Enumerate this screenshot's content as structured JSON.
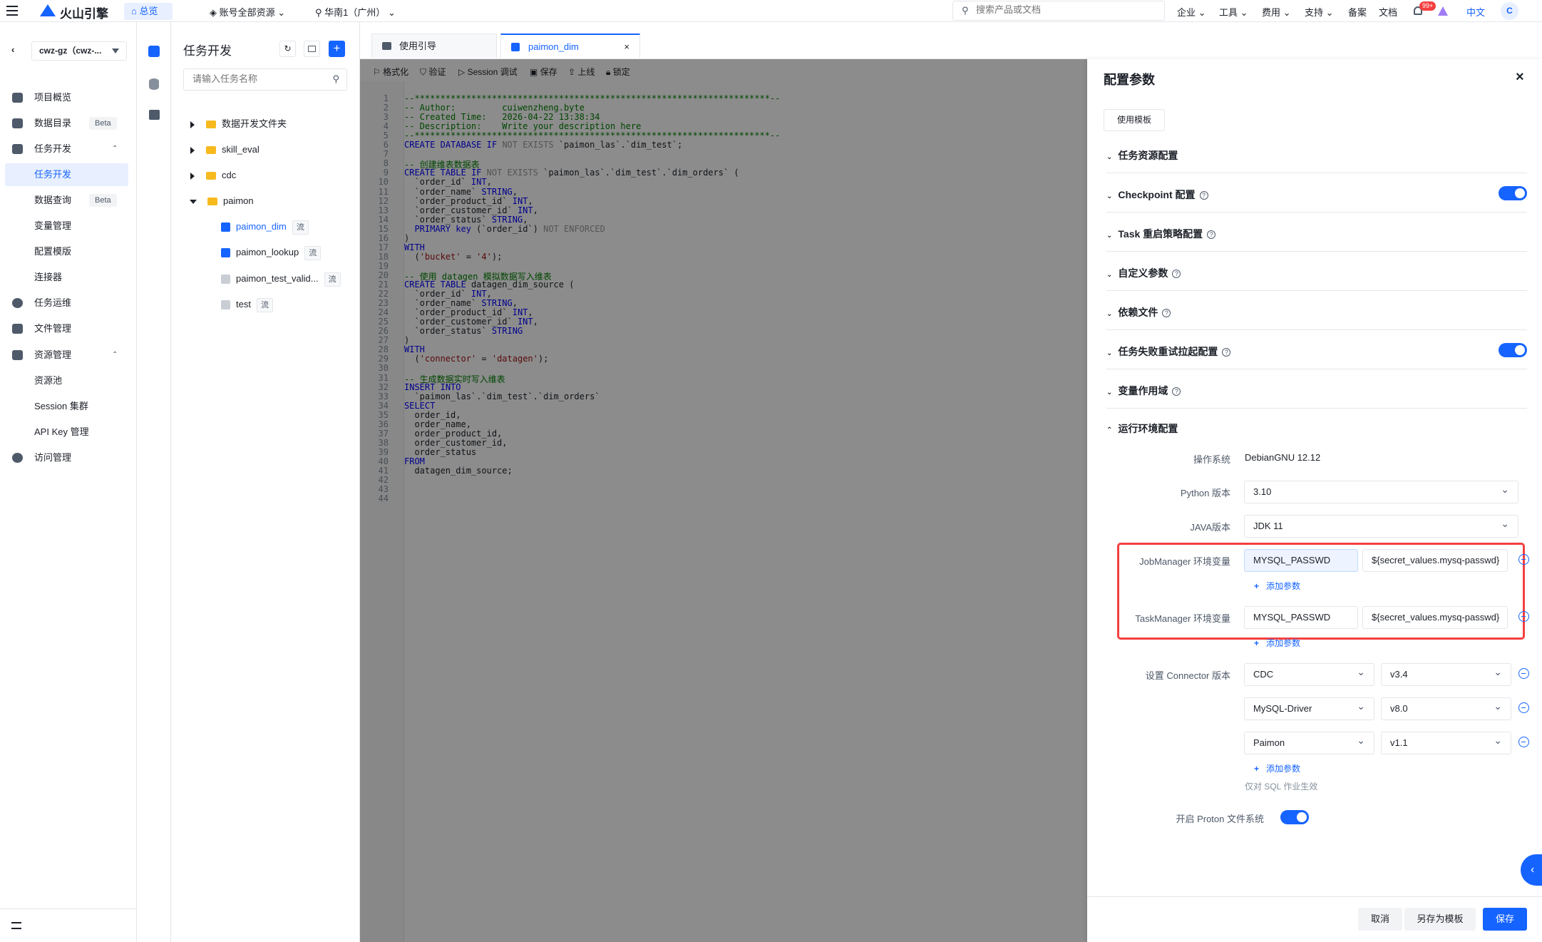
{
  "topbar": {
    "brand": "火山引擎",
    "home": "总览",
    "account": "账号全部资源",
    "region": "华南1（广州）",
    "search_placeholder": "搜索产品或文档",
    "menus": [
      "企业",
      "工具",
      "费用",
      "支持",
      "备案",
      "文档"
    ],
    "notify_count": "99+",
    "lang": "中文",
    "avatar": "C"
  },
  "leftnav": {
    "project": "cwz-gz（cwz-...",
    "items": [
      {
        "label": "项目概览"
      },
      {
        "label": "数据目录",
        "badge": "Beta"
      },
      {
        "label": "任务开发"
      },
      {
        "label": "任务开发"
      },
      {
        "label": "数据查询",
        "badge": "Beta"
      },
      {
        "label": "变量管理"
      },
      {
        "label": "配置模版"
      },
      {
        "label": "连接器"
      },
      {
        "label": "任务运维"
      },
      {
        "label": "文件管理"
      },
      {
        "label": "资源管理"
      },
      {
        "label": "资源池"
      },
      {
        "label": "Session 集群"
      },
      {
        "label": "API Key 管理"
      },
      {
        "label": "访问管理"
      }
    ]
  },
  "tree": {
    "title": "任务开发",
    "search_placeholder": "请输入任务名称",
    "folders": [
      "数据开发文件夹",
      "skill_eval",
      "cdc",
      "paimon"
    ],
    "files": [
      {
        "name": "paimon_dim",
        "tag": "流"
      },
      {
        "name": "paimon_lookup",
        "tag": "流"
      },
      {
        "name": "paimon_test_valid...",
        "tag": "流"
      },
      {
        "name": "test",
        "tag": "流"
      }
    ]
  },
  "editor": {
    "tabs": [
      "使用引导",
      "paimon_dim"
    ],
    "toolbar": [
      "格式化",
      "验证",
      "Session 调试",
      "保存",
      "上线",
      "锁定"
    ],
    "lines": [
      "--*********************************************************************--",
      "-- Author:         cuiwenzheng.byte",
      "-- Created Time:   2026-04-22 13:38:34",
      "-- Description:    Write your description here",
      "--*********************************************************************--",
      "CREATE DATABASE IF NOT EXISTS `paimon_las`.`dim_test`;",
      "",
      "-- 创建维表数据表",
      "CREATE TABLE IF NOT EXISTS `paimon_las`.`dim_test`.`dim_orders` (",
      "  `order_id` INT,",
      "  `order_name` STRING,",
      "  `order_product_id` INT,",
      "  `order_customer_id` INT,",
      "  `order_status` STRING,",
      "  PRIMARY key (`order_id`) NOT ENFORCED",
      ")",
      "WITH",
      "  ('bucket' = '4');",
      "",
      "-- 使用 datagen 模拟数据写入维表",
      "CREATE TABLE datagen_dim_source (",
      "  `order_id` INT,",
      "  `order_name` STRING,",
      "  `order_product_id` INT,",
      "  `order_customer_id` INT,",
      "  `order_status` STRING",
      ")",
      "WITH",
      "  ('connector' = 'datagen');",
      "",
      "-- 生成数据实时写入维表",
      "INSERT INTO",
      "  `paimon_las`.`dim_test`.`dim_orders`",
      "SELECT",
      "  order_id,",
      "  order_name,",
      "  order_product_id,",
      "  order_customer_id,",
      "  order_status",
      "FROM",
      "  datagen_dim_source;",
      "",
      "",
      ""
    ]
  },
  "drawer": {
    "title": "配置参数",
    "use_template": "使用模板",
    "sections": [
      {
        "label": "任务资源配置",
        "help": false,
        "toggle": false
      },
      {
        "label": "Checkpoint 配置",
        "help": true,
        "toggle": true
      },
      {
        "label": "Task 重启策略配置",
        "help": true,
        "toggle": false
      },
      {
        "label": "自定义参数",
        "help": true,
        "toggle": false
      },
      {
        "label": "依赖文件",
        "help": true,
        "toggle": false
      },
      {
        "label": "任务失败重试拉起配置",
        "help": true,
        "toggle": true
      },
      {
        "label": "变量作用域",
        "help": true,
        "toggle": false
      }
    ],
    "runtime_title": "运行环境配置",
    "os_label": "操作系统",
    "os_value": "DebianGNU 12.12",
    "python_label": "Python 版本",
    "python_value": "3.10",
    "java_label": "JAVA版本",
    "java_value": "JDK 11",
    "jm_label": "JobManager 环境变量",
    "jm_key": "MYSQL_PASSWD",
    "jm_value": "${secret_values.mysq-passwd}",
    "tm_label": "TaskManager 环境变量",
    "tm_key": "MYSQL_PASSWD",
    "tm_value": "${secret_values.mysq-passwd}",
    "add_param": "添加参数",
    "connector_label": "设置 Connector 版本",
    "connectors": [
      {
        "name": "CDC",
        "version": "v3.4"
      },
      {
        "name": "MySQL-Driver",
        "version": "v8.0"
      },
      {
        "name": "Paimon",
        "version": "v1.1"
      }
    ],
    "sql_only_note": "仅对 SQL 作业生效",
    "proton_label": "开启 Proton 文件系统",
    "cancel": "取消",
    "save_as_template": "另存为模板",
    "save": "保存",
    "highlight_color": "#f53f3f"
  }
}
